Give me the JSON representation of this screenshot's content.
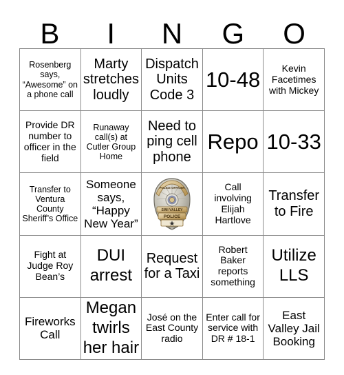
{
  "header": {
    "letters": [
      "B",
      "I",
      "N",
      "G",
      "O"
    ]
  },
  "grid": {
    "rows": [
      [
        {
          "text": "Rosenberg says, “Awesome” on a phone call",
          "size": "xs"
        },
        {
          "text": "Marty stretches loudly",
          "size": "lg"
        },
        {
          "text": "Dispatch Units Code 3",
          "size": "lg"
        },
        {
          "text": "10-48",
          "size": "xxl"
        },
        {
          "text": "Kevin Facetimes with Mickey",
          "size": "sm"
        }
      ],
      [
        {
          "text": "Provide DR number to officer in the field",
          "size": "sm"
        },
        {
          "text": "Runaway call(s) at Cutler Group Home",
          "size": "xs"
        },
        {
          "text": "Need to ping cell phone",
          "size": "lg"
        },
        {
          "text": "Repo",
          "size": "xxl"
        },
        {
          "text": "10-33",
          "size": "xxl"
        }
      ],
      [
        {
          "text": "Transfer to Ventura County Sheriff’s Office",
          "size": "xs"
        },
        {
          "text": "Someone says, “Happy New Year”",
          "size": "md"
        },
        {
          "type": "free",
          "icon": "police-badge-icon",
          "badge_top_text": "POLICE OFFICER",
          "badge_mid_text": "SIMI VALLEY",
          "badge_bottom_text": "POLICE"
        },
        {
          "text": "Call involving Elijah Hartlove",
          "size": "sm"
        },
        {
          "text": "Transfer to Fire",
          "size": "lg"
        }
      ],
      [
        {
          "text": "Fight at Judge Roy Bean’s",
          "size": "sm"
        },
        {
          "text": "DUI arrest",
          "size": "xl"
        },
        {
          "text": "Request for a Taxi",
          "size": "lg"
        },
        {
          "text": "Robert Baker reports something",
          "size": "sm"
        },
        {
          "text": "Utilize LLS",
          "size": "xl"
        }
      ],
      [
        {
          "text": "Fireworks Call",
          "size": "md"
        },
        {
          "text": "Megan twirls her hair",
          "size": "xl"
        },
        {
          "text": "José on the East County radio",
          "size": "sm"
        },
        {
          "text": "Enter call for service with DR # 18-1",
          "size": "sm"
        },
        {
          "text": "East Valley Jail Booking",
          "size": "md"
        }
      ]
    ]
  },
  "colors": {
    "grid_line": "#8a8a8a",
    "text": "#000000",
    "background": "#ffffff",
    "badge_silver": "#b9b7ae",
    "badge_gold": "#c9a76a"
  }
}
